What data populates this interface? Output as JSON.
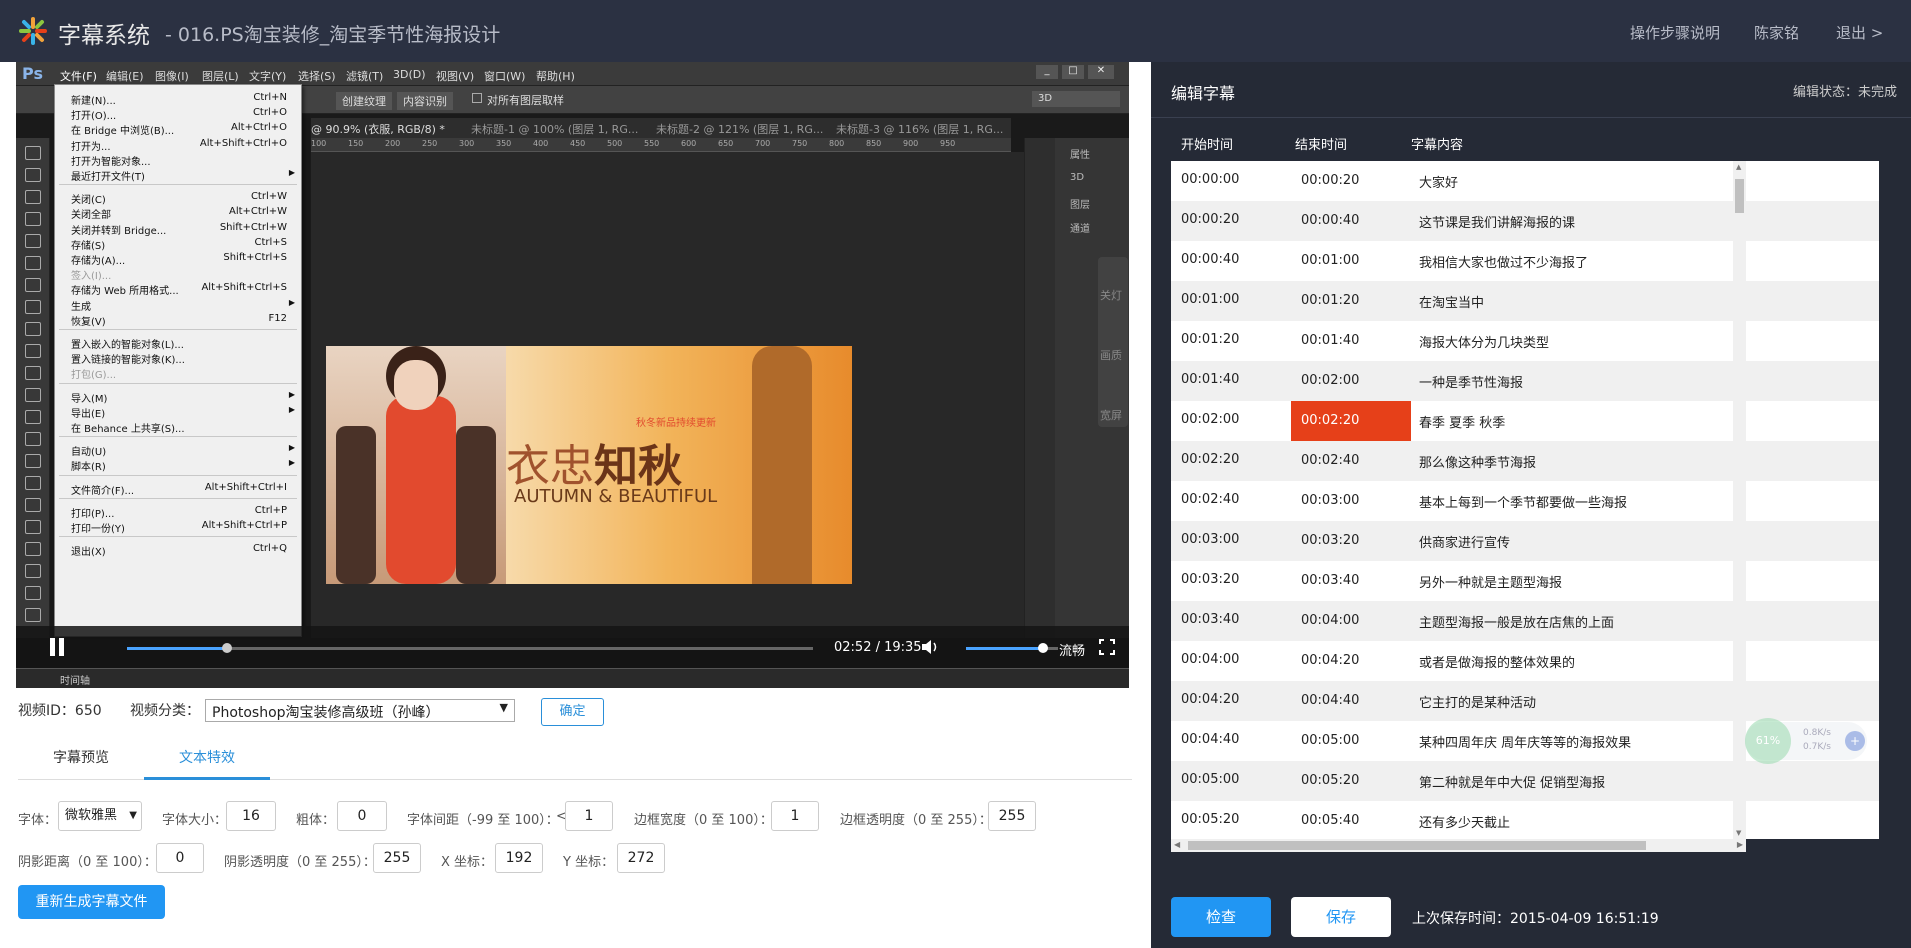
{
  "header": {
    "app_title": "字幕系统",
    "course_title": "- 016.PS淘宝装修_淘宝季节性海报设计",
    "nav": [
      "操作步骤说明",
      "陈家铭",
      "退出 >"
    ]
  },
  "photoshop": {
    "menus": [
      "文件(F)",
      "编辑(E)",
      "图像(I)",
      "图层(L)",
      "文字(Y)",
      "选择(S)",
      "滤镜(T)",
      "3D(D)",
      "视图(V)",
      "窗口(W)",
      "帮助(H)"
    ],
    "options": [
      "创建纹理",
      "内容识别",
      "对所有图层取样"
    ],
    "mode_3d": "3D",
    "tabs": [
      "@ 90.9% (衣服, RGB/8) *",
      "未标题-1 @ 100% (图层 1, RG...",
      "未标题-2 @ 121% (图层 1, RG...",
      "未标题-3 @ 116% (图层 1, RG..."
    ],
    "ruler": [
      "100",
      "150",
      "200",
      "250",
      "300",
      "350",
      "400",
      "450",
      "500",
      "550",
      "600",
      "650",
      "700",
      "750",
      "800",
      "850",
      "900",
      "950"
    ],
    "right_panel": [
      "属性",
      "3D",
      "图层",
      "通道"
    ],
    "side_float": [
      "关灯",
      "画质",
      "宽屏"
    ],
    "banner": {
      "title_a": "衣忠",
      "title_b": "知秋",
      "subtitle": "AUTUMN & BEAUTIFUL",
      "tagline": "秋冬新品持续更新"
    },
    "status_bar": "时间轴",
    "file_menu": [
      {
        "label": "新建(N)...",
        "shortcut": "Ctrl+N"
      },
      {
        "label": "打开(O)...",
        "shortcut": "Ctrl+O"
      },
      {
        "label": "在 Bridge 中浏览(B)...",
        "shortcut": "Alt+Ctrl+O"
      },
      {
        "label": "打开为...",
        "shortcut": "Alt+Shift+Ctrl+O"
      },
      {
        "label": "打开为智能对象...",
        "shortcut": ""
      },
      {
        "label": "最近打开文件(T)",
        "shortcut": "",
        "submenu": true
      },
      {
        "sep": true
      },
      {
        "label": "关闭(C)",
        "shortcut": "Ctrl+W"
      },
      {
        "label": "关闭全部",
        "shortcut": "Alt+Ctrl+W"
      },
      {
        "label": "关闭并转到 Bridge...",
        "shortcut": "Shift+Ctrl+W"
      },
      {
        "label": "存储(S)",
        "shortcut": "Ctrl+S"
      },
      {
        "label": "存储为(A)...",
        "shortcut": "Shift+Ctrl+S"
      },
      {
        "label": "签入(I)...",
        "shortcut": "",
        "disabled": true
      },
      {
        "label": "存储为 Web 所用格式...",
        "shortcut": "Alt+Shift+Ctrl+S"
      },
      {
        "label": "生成",
        "shortcut": "",
        "submenu": true
      },
      {
        "label": "恢复(V)",
        "shortcut": "F12"
      },
      {
        "sep": true
      },
      {
        "label": "置入嵌入的智能对象(L)...",
        "shortcut": ""
      },
      {
        "label": "置入链接的智能对象(K)...",
        "shortcut": ""
      },
      {
        "label": "打包(G)...",
        "shortcut": "",
        "disabled": true
      },
      {
        "sep": true
      },
      {
        "label": "导入(M)",
        "shortcut": "",
        "submenu": true
      },
      {
        "label": "导出(E)",
        "shortcut": "",
        "submenu": true
      },
      {
        "label": "在 Behance 上共享(S)...",
        "shortcut": ""
      },
      {
        "sep": true
      },
      {
        "label": "自动(U)",
        "shortcut": "",
        "submenu": true
      },
      {
        "label": "脚本(R)",
        "shortcut": "",
        "submenu": true
      },
      {
        "sep": true
      },
      {
        "label": "文件简介(F)...",
        "shortcut": "Alt+Shift+Ctrl+I"
      },
      {
        "sep": true
      },
      {
        "label": "打印(P)...",
        "shortcut": "Ctrl+P"
      },
      {
        "label": "打印一份(Y)",
        "shortcut": "Alt+Shift+Ctrl+P"
      },
      {
        "sep": true
      },
      {
        "label": "退出(X)",
        "shortcut": "Ctrl+Q"
      }
    ]
  },
  "player": {
    "time": "02:52 / 19:35",
    "progress_fraction": 0.146,
    "volume_fraction": 0.84,
    "quality": "流畅"
  },
  "video_meta": {
    "id_label": "视频ID：650",
    "category_label": "视频分类：",
    "category_value": "Photoshop淘宝装修高级班（孙峰）",
    "confirm": "确定"
  },
  "tabs": [
    "字幕预览",
    "文本特效"
  ],
  "active_tab": 1,
  "effects": {
    "font_label": "字体：",
    "font_value": "微软雅黑",
    "size_label": "字体大小：",
    "size_value": "16",
    "bold_label": "粗体：",
    "bold_value": "0",
    "spacing_label": "字体间距（-99 至 100）：",
    "spacing_prefix": "<",
    "spacing_value": "1",
    "border_w_label": "边框宽度（0 至 100）：",
    "border_w_value": "1",
    "border_a_label": "边框透明度（0 至 255）：",
    "border_a_value": "255",
    "shadow_d_label": "阴影距离（0 至 100）：",
    "shadow_d_value": "0",
    "shadow_a_label": "阴影透明度（0 至 255）：",
    "shadow_a_value": "255",
    "x_label": "X 坐标：",
    "x_value": "192",
    "y_label": "Y 坐标：",
    "y_value": "272",
    "regen": "重新生成字幕文件"
  },
  "editor": {
    "title": "编辑字幕",
    "status": "编辑状态：未完成",
    "headers": [
      "开始时间",
      "结束时间",
      "字幕内容"
    ],
    "rows": [
      {
        "start": "00:00:00",
        "end": "00:00:20",
        "text": "大家好"
      },
      {
        "start": "00:00:20",
        "end": "00:00:40",
        "text": "这节课是我们讲解海报的课"
      },
      {
        "start": "00:00:40",
        "end": "00:01:00",
        "text": "我相信大家也做过不少海报了"
      },
      {
        "start": "00:01:00",
        "end": "00:01:20",
        "text": "在淘宝当中"
      },
      {
        "start": "00:01:20",
        "end": "00:01:40",
        "text": "海报大体分为几块类型"
      },
      {
        "start": "00:01:40",
        "end": "00:02:00",
        "text": "一种是季节性海报"
      },
      {
        "start": "00:02:00",
        "end": "00:02:20",
        "text": "春季 夏季 秋季",
        "highlight": true
      },
      {
        "start": "00:02:20",
        "end": "00:02:40",
        "text": "那么像这种季节海报"
      },
      {
        "start": "00:02:40",
        "end": "00:03:00",
        "text": "基本上每到一个季节都要做一些海报"
      },
      {
        "start": "00:03:00",
        "end": "00:03:20",
        "text": "供商家进行宣传"
      },
      {
        "start": "00:03:20",
        "end": "00:03:40",
        "text": "另外一种就是主题型海报"
      },
      {
        "start": "00:03:40",
        "end": "00:04:00",
        "text": "主题型海报一般是放在店焦的上面"
      },
      {
        "start": "00:04:00",
        "end": "00:04:20",
        "text": "或者是做海报的整体效果的"
      },
      {
        "start": "00:04:20",
        "end": "00:04:40",
        "text": "它主打的是某种活动"
      },
      {
        "start": "00:04:40",
        "end": "00:05:00",
        "text": "某种四周年庆  周年庆等等的海报效果"
      },
      {
        "start": "00:05:00",
        "end": "00:05:20",
        "text": "第二种就是年中大促  促销型海报"
      },
      {
        "start": "00:05:20",
        "end": "00:05:40",
        "text": "还有多少天截止"
      }
    ],
    "check": "检查",
    "save": "保存",
    "last_save": "上次保存时间：2015-04-09 16:51:19"
  },
  "net_widget": {
    "percent": "61%",
    "up": "0.8K/s",
    "down": "0.7K/s"
  },
  "colors": {
    "topbar": "#2b3142",
    "accent": "#2196f3",
    "highlight": "#e64019",
    "panel": "#252a36"
  }
}
